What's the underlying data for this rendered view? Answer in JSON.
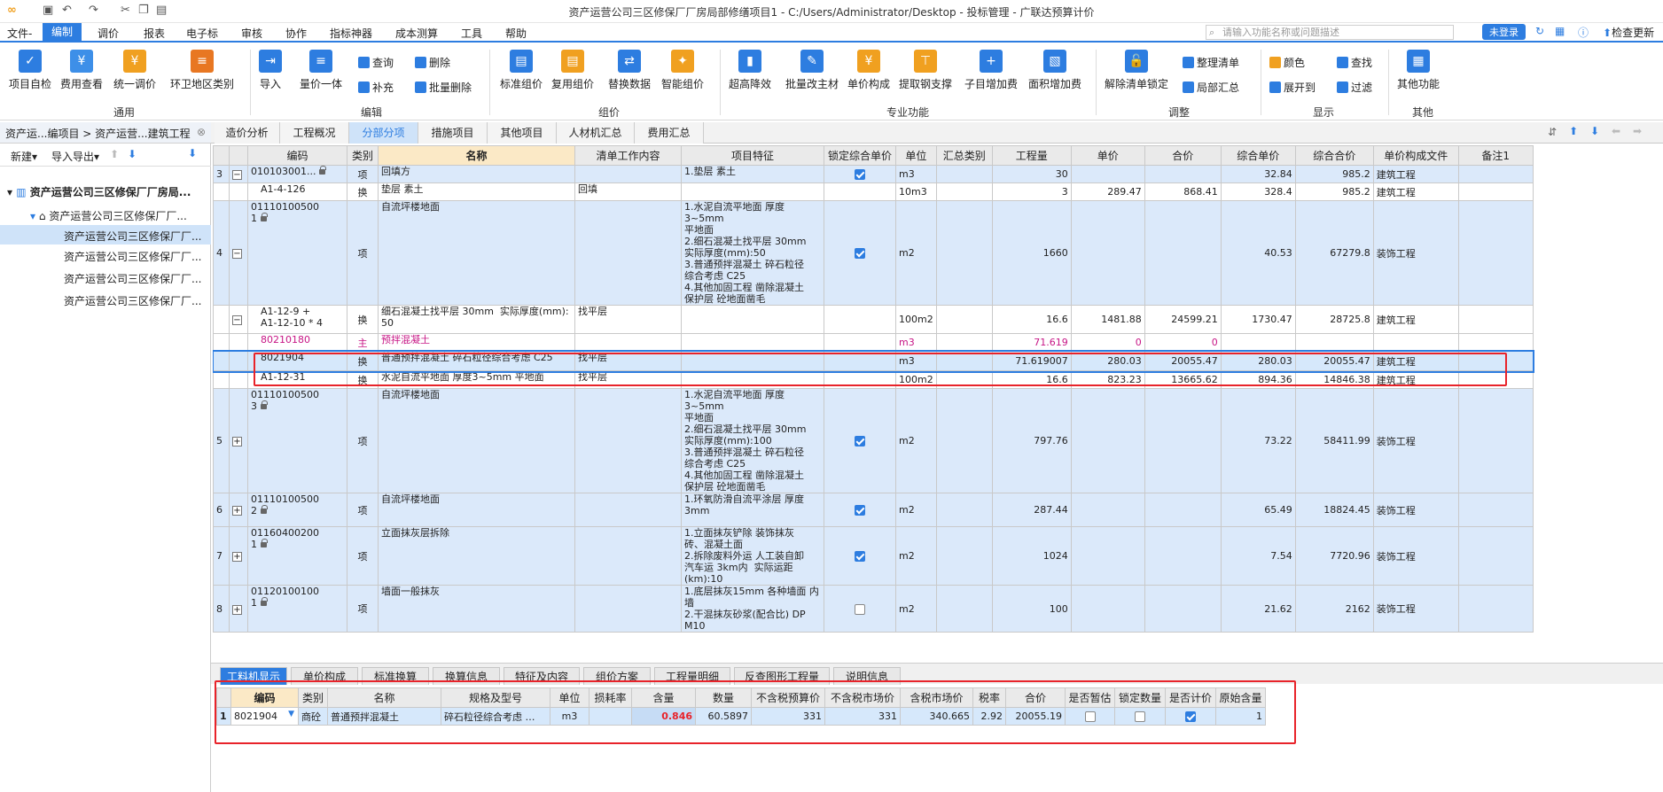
{
  "window": {
    "title": "资产运营公司三区修保厂厂房局部修缮项目1 - C:/Users/Administrator/Desktop - 投标管理 - 广联达预算计价"
  },
  "menu": [
    "文件-",
    "编制",
    "调价",
    "报表",
    "电子标",
    "审核",
    "协作",
    "指标神器",
    "成本测算",
    "工具",
    "帮助"
  ],
  "search": {
    "placeholder": "请输入功能名称或问题描述"
  },
  "login": "未登录",
  "top_right": {
    "check": "检查更新"
  },
  "ribbon": {
    "common": {
      "label": "通用",
      "buttons": [
        "项目自检",
        "费用查看",
        "统一调价",
        "环卫地区类别"
      ]
    },
    "edit": {
      "label": "编辑",
      "buttons": [
        "导入",
        "量价一体"
      ],
      "small": [
        "查询",
        "删除",
        "补充",
        "批量删除"
      ]
    },
    "compose": {
      "label": "组价",
      "buttons": [
        "标准组价",
        "复用组价",
        "替换数据",
        "智能组价"
      ]
    },
    "pro": {
      "label": "专业功能",
      "buttons": [
        "超高降效",
        "批量改主材",
        "单价构成",
        "提取钢支撑",
        "子目增加费",
        "面积增加费"
      ]
    },
    "adjust": {
      "label": "调整",
      "buttons": [
        "解除清单锁定"
      ],
      "small": [
        "整理清单",
        "局部汇总"
      ]
    },
    "display": {
      "label": "显示",
      "small": [
        "颜色",
        "查找",
        "展开到",
        "过滤"
      ]
    },
    "other": {
      "label": "其他",
      "buttons": [
        "其他功能"
      ]
    }
  },
  "left": {
    "breadcrumb": "资产运...编项目 > 资产运营...建筑工程",
    "tools": [
      "新建",
      "导入导出"
    ],
    "tree": [
      "资产运营公司三区修保厂厂房局...",
      "资产运营公司三区修保厂厂...",
      "资产运营公司三区修保厂厂...",
      "资产运营公司三区修保厂厂...",
      "资产运营公司三区修保厂厂...",
      "资产运营公司三区修保厂厂..."
    ]
  },
  "tabs": [
    "造价分析",
    "工程概况",
    "分部分项",
    "措施项目",
    "其他项目",
    "人材机汇总",
    "费用汇总"
  ],
  "grid": {
    "headers": [
      "编码",
      "类别",
      "名称",
      "清单工作内容",
      "项目特征",
      "锁定综合单价",
      "单位",
      "汇总类别",
      "工程量",
      "单价",
      "合价",
      "综合单价",
      "综合合价",
      "单价构成文件",
      "备注1"
    ],
    "rows": [
      {
        "no": "3",
        "code": "010103001...",
        "type": "项",
        "name": "回填方",
        "work": "",
        "feat": "1.垫层 素土",
        "lock": true,
        "unit": "m3",
        "qty": "30",
        "price": "",
        "total": "",
        "uprice": "32.84",
        "utotal": "985.2",
        "file": "建筑工程"
      },
      {
        "no": "",
        "code": "A1-4-126",
        "type": "换",
        "name": "垫层 素土",
        "work": "回填",
        "feat": "",
        "lock": null,
        "unit": "10m3",
        "qty": "3",
        "price": "289.47",
        "total": "868.41",
        "uprice": "328.4",
        "utotal": "985.2",
        "file": "建筑工程"
      },
      {
        "no": "4",
        "code": "01110100500\n1",
        "type": "项",
        "name": "自流坪楼地面",
        "work": "",
        "feat": "1.水泥自流平地面 厚度3~5mm\n平地面\n2.细石混凝土找平层 30mm\n实际厚度(mm):50\n3.普通预拌混凝土 碎石粒径\n综合考虑 C25\n4.其他加固工程 凿除混凝土\n保护层 砼地面凿毛",
        "lock": true,
        "unit": "m2",
        "qty": "1660",
        "price": "",
        "total": "",
        "uprice": "40.53",
        "utotal": "67279.8",
        "file": "装饰工程"
      },
      {
        "no": "",
        "code": "A1-12-9 +\nA1-12-10 * 4",
        "type": "换",
        "name": "细石混凝土找平层 30mm  实际厚度(mm):\n50",
        "work": "找平层",
        "feat": "",
        "lock": null,
        "unit": "100m2",
        "qty": "16.6",
        "price": "1481.88",
        "total": "24599.21",
        "uprice": "1730.47",
        "utotal": "28725.8",
        "file": "建筑工程"
      },
      {
        "no": "",
        "code": "80210180",
        "type": "主",
        "name": "预拌混凝土",
        "work": "",
        "feat": "",
        "lock": null,
        "unit": "m3",
        "qty": "71.619",
        "price": "0",
        "total": "0",
        "uprice": "",
        "utotal": "",
        "file": ""
      },
      {
        "no": "",
        "code": "8021904",
        "type": "换",
        "name": "普通预拌混凝土 碎石粒径综合考虑 C25",
        "work": "找平层",
        "feat": "",
        "lock": null,
        "unit": "m3",
        "qty": "71.619007",
        "price": "280.03",
        "total": "20055.47",
        "uprice": "280.03",
        "utotal": "20055.47",
        "file": "建筑工程"
      },
      {
        "no": "",
        "code": "A1-12-31",
        "type": "换",
        "name": "水泥自流平地面 厚度3~5mm 平地面",
        "work": "找平层",
        "feat": "",
        "lock": null,
        "unit": "100m2",
        "qty": "16.6",
        "price": "823.23",
        "total": "13665.62",
        "uprice": "894.36",
        "utotal": "14846.38",
        "file": "建筑工程"
      },
      {
        "no": "5",
        "code": "01110100500\n3",
        "type": "项",
        "name": "自流坪楼地面",
        "work": "",
        "feat": "1.水泥自流平地面 厚度3~5mm\n平地面\n2.细石混凝土找平层 30mm\n实际厚度(mm):100\n3.普通预拌混凝土 碎石粒径\n综合考虑 C25\n4.其他加固工程 凿除混凝土\n保护层 砼地面凿毛",
        "lock": true,
        "unit": "m2",
        "qty": "797.76",
        "price": "",
        "total": "",
        "uprice": "73.22",
        "utotal": "58411.99",
        "file": "装饰工程"
      },
      {
        "no": "6",
        "code": "01110100500\n2",
        "type": "项",
        "name": "自流坪楼地面",
        "work": "",
        "feat": "1.环氧防滑自流平涂层 厚度\n3mm",
        "lock": true,
        "unit": "m2",
        "qty": "287.44",
        "price": "",
        "total": "",
        "uprice": "65.49",
        "utotal": "18824.45",
        "file": "装饰工程"
      },
      {
        "no": "7",
        "code": "01160400200\n1",
        "type": "项",
        "name": "立面抹灰层拆除",
        "work": "",
        "feat": "1.立面抹灰铲除 装饰抹灰\n砖、混凝土面\n2.拆除废料外运 人工装自卸\n汽车运 3km内  实际运距\n(km):10",
        "lock": true,
        "unit": "m2",
        "qty": "1024",
        "price": "",
        "total": "",
        "uprice": "7.54",
        "utotal": "7720.96",
        "file": "装饰工程"
      },
      {
        "no": "8",
        "code": "01120100100\n1",
        "type": "项",
        "name": "墙面一般抹灰",
        "work": "",
        "feat": "1.底层抹灰15mm 各种墙面 内\n墙\n2.干混抹灰砂浆(配合比) DP\nM10",
        "lock": false,
        "unit": "m2",
        "qty": "100",
        "price": "",
        "total": "",
        "uprice": "21.62",
        "utotal": "2162",
        "file": "装饰工程"
      }
    ]
  },
  "bottom_tabs": [
    "工料机显示",
    "单价构成",
    "标准换算",
    "换算信息",
    "特征及内容",
    "组价方案",
    "工程量明细",
    "反查图形工程量",
    "说明信息"
  ],
  "bottom_grid": {
    "headers": [
      "编码",
      "类别",
      "名称",
      "规格及型号",
      "单位",
      "损耗率",
      "含量",
      "数量",
      "不含税预算价",
      "不含税市场价",
      "含税市场价",
      "税率",
      "合价",
      "是否暂估",
      "锁定数量",
      "是否计价",
      "原始含量"
    ],
    "row": {
      "no": "1",
      "code": "8021904",
      "type": "商砼",
      "name": "普通预拌混凝土",
      "spec": "碎石粒径综合考虑 …",
      "unit": "m3",
      "loss": "",
      "content": "0.846",
      "qty": "60.5897",
      "budget": "331",
      "market": "331",
      "market_tax": "340.665",
      "tax": "2.92",
      "total": "20055.19",
      "temp": false,
      "lockqty": false,
      "price_on": true,
      "orig": "1"
    }
  },
  "colors": {
    "accent": "#2d7de0",
    "highlight": "#e8232a",
    "selected_row": "#d6e8fb",
    "list_row": "#dbe9fa"
  }
}
